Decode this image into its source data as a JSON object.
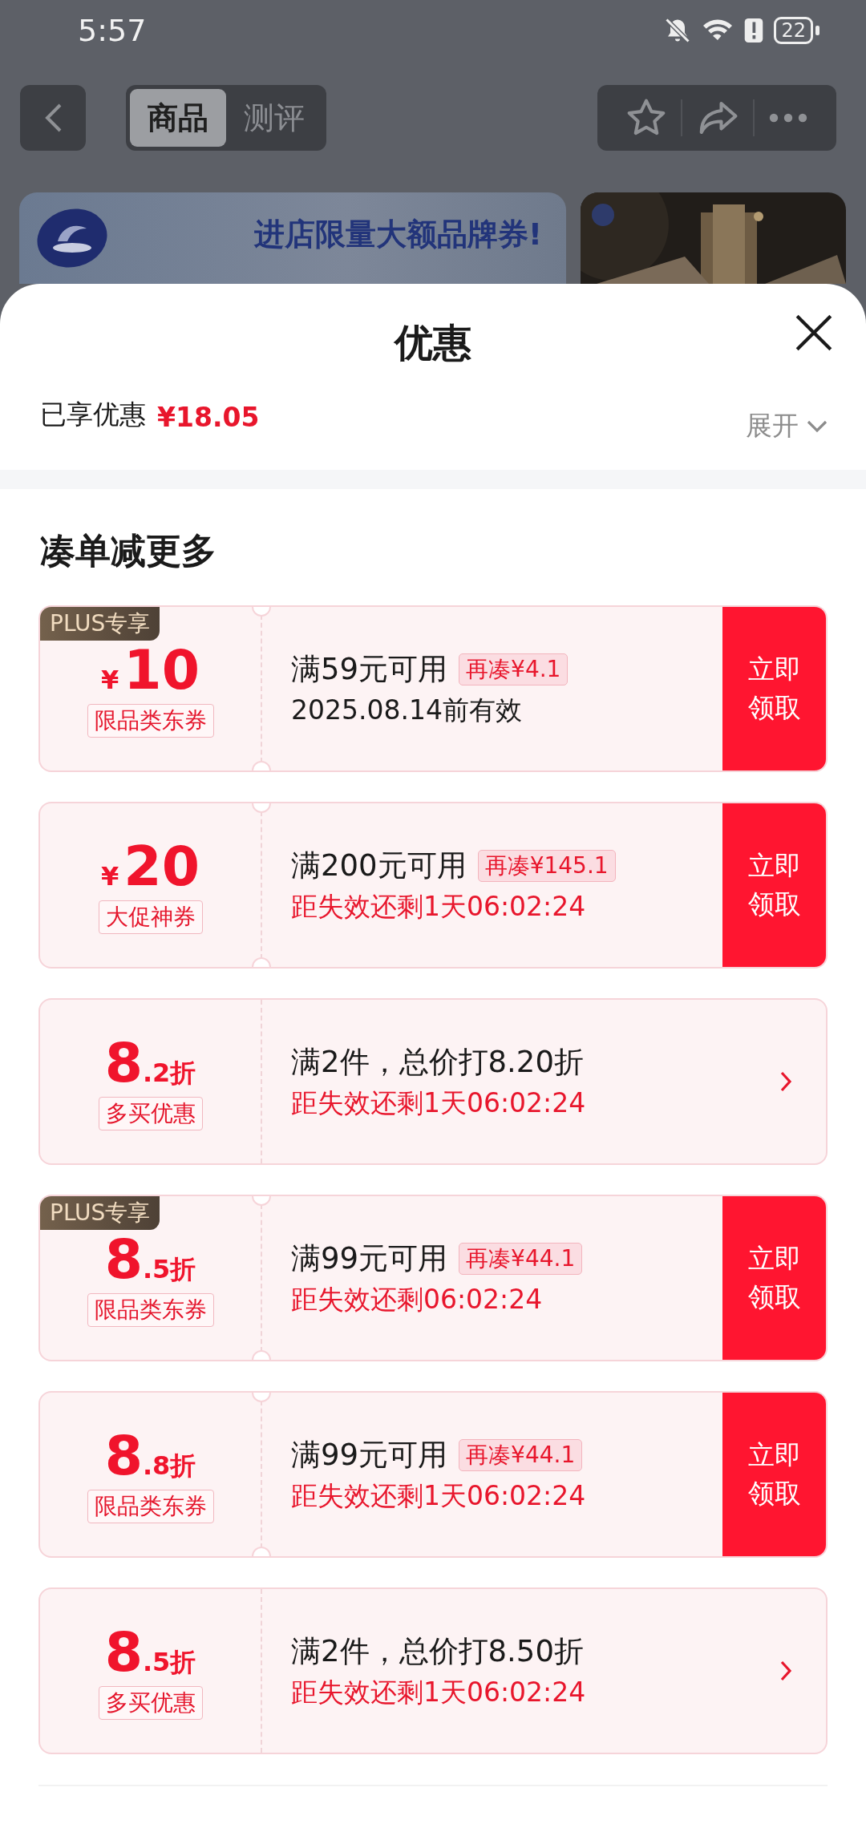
{
  "status_bar": {
    "time": "5:57",
    "battery": "22"
  },
  "nav": {
    "tabs": [
      {
        "label": "商品",
        "selected": true
      },
      {
        "label": "测评",
        "selected": false
      }
    ]
  },
  "banner": {
    "headline": "进店限量大额品牌券!"
  },
  "sheet": {
    "title": "优惠",
    "saved_label": "已享优惠",
    "saved_amount": "¥18.05",
    "expand": "展开",
    "section_title": "凑单减更多",
    "coupons": [
      {
        "kind": "cash",
        "plus": "PLUS专享",
        "prefix": "¥",
        "value": "10",
        "tag": "限品类东券",
        "condition": "满59元可用",
        "extra": "再凑¥4.1",
        "validity": "2025.08.14前有效",
        "urgent": false,
        "claim": "立即领取"
      },
      {
        "kind": "cash",
        "prefix": "¥",
        "value": "20",
        "tag": "大促神券",
        "condition": "满200元可用",
        "extra": "再凑¥145.1",
        "validity": "距失效还剩1天06:02:24",
        "urgent": true,
        "claim": "立即领取"
      },
      {
        "kind": "discount",
        "value": "8",
        "suffix": ".2折",
        "tag": "多买优惠",
        "condition": "满2件，总价打8.20折",
        "validity": "距失效还剩1天06:02:24",
        "urgent": true,
        "arrow": true
      },
      {
        "kind": "discount",
        "plus": "PLUS专享",
        "value": "8",
        "suffix": ".5折",
        "tag": "限品类东券",
        "condition": "满99元可用",
        "extra": "再凑¥44.1",
        "validity": "距失效还剩06:02:24",
        "urgent": true,
        "claim": "立即领取"
      },
      {
        "kind": "discount",
        "value": "8",
        "suffix": ".8折",
        "tag": "限品类东券",
        "condition": "满99元可用",
        "extra": "再凑¥44.1",
        "validity": "距失效还剩1天06:02:24",
        "urgent": true,
        "claim": "立即领取"
      },
      {
        "kind": "discount",
        "value": "8",
        "suffix": ".5折",
        "tag": "多买优惠",
        "condition": "满2件，总价打8.50折",
        "validity": "距失效还剩1天06:02:24",
        "urgent": true,
        "arrow": true
      }
    ]
  }
}
